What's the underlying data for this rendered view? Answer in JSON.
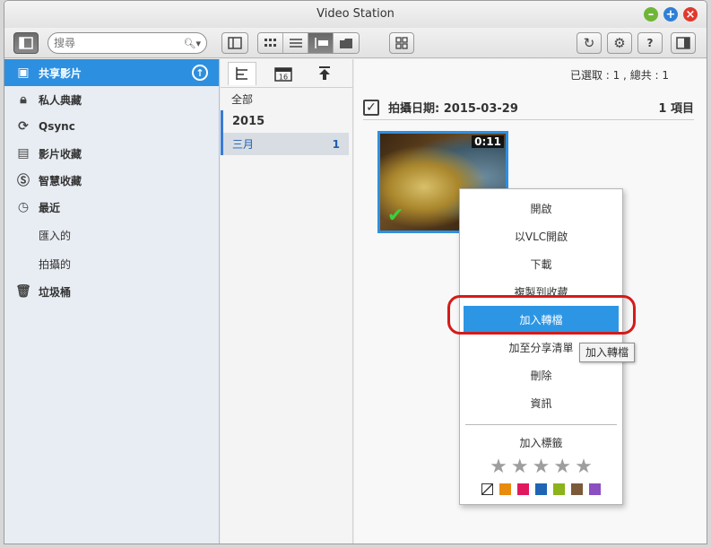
{
  "window": {
    "title": "Video Station"
  },
  "toolbar": {
    "search_placeholder": "搜尋"
  },
  "sidebar": {
    "items": [
      {
        "label": "共享影片",
        "icon": "film-icon",
        "active": true
      },
      {
        "label": "私人典藏",
        "icon": "lock-icon"
      },
      {
        "label": "Qsync",
        "icon": "sync-icon"
      },
      {
        "label": "影片收藏",
        "icon": "collection-icon"
      },
      {
        "label": "智慧收藏",
        "icon": "smart-collection-icon"
      },
      {
        "label": "最近",
        "icon": "clock-icon"
      },
      {
        "label": "匯入的",
        "sub": true
      },
      {
        "label": "拍攝的",
        "sub": true
      },
      {
        "label": "垃圾桶",
        "icon": "trash-icon"
      }
    ]
  },
  "timeline": {
    "all": "全部",
    "year": "2015",
    "month": "三月",
    "month_count": "1",
    "calendar_day": "16"
  },
  "main": {
    "selection_info": "已選取 : 1 , 總共 : 1",
    "group_title": "拍攝日期: 2015-03-29",
    "group_count": "1 項目",
    "thumb_duration": "0:11"
  },
  "context_menu": {
    "items": [
      "開啟",
      "以VLC開啟",
      "下載",
      "複製到收藏",
      "加入轉檔",
      "加至分享清單",
      "刪除",
      "資訊"
    ],
    "highlighted": "加入轉檔",
    "tag_label": "加入標籤",
    "colors": [
      "#e98b0c",
      "#e0195e",
      "#1f65b4",
      "#8bb31c",
      "#7b5a3a",
      "#8b4fc1"
    ]
  },
  "tooltip": "加入轉檔"
}
